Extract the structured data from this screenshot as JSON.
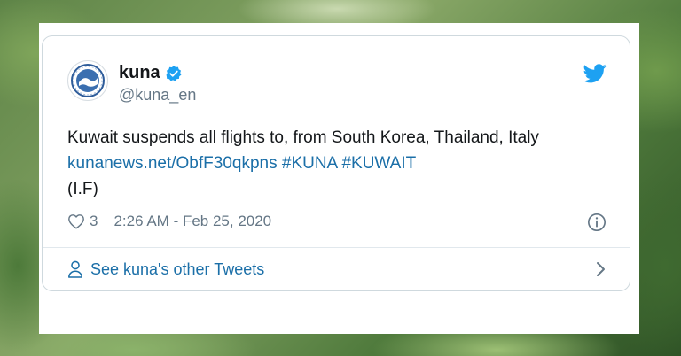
{
  "tweet": {
    "display_name": "kuna",
    "handle": "@kuna_en",
    "text_line1": "Kuwait suspends all flights to, from South Korea, Thailand, Italy",
    "link": "kunanews.net/ObfF30qkpns",
    "hashtag1": "#KUNA",
    "hashtag2": "#KUWAIT",
    "text_line3": "(I.F)",
    "like_count": "3",
    "timestamp": "2:26 AM - Feb 25, 2020",
    "icons": {
      "avatar": "kuna-logo",
      "verified": "verified-badge-icon",
      "brand": "twitter-bird-icon",
      "like": "heart-icon",
      "info": "info-icon",
      "profile": "person-icon",
      "chevron": "chevron-right-icon"
    }
  },
  "footer": {
    "label": "See kuna's other Tweets"
  },
  "colors": {
    "link": "#1b6fa8",
    "brand": "#1da1f2",
    "text": "#14171a",
    "muted": "#657786",
    "border": "#cfd9de"
  }
}
